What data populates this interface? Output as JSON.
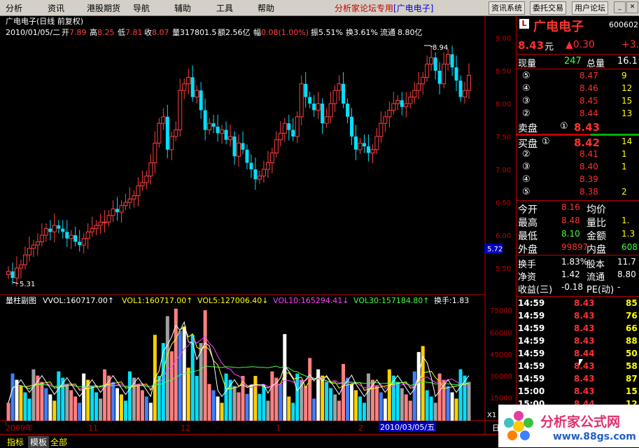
{
  "menu": {
    "items": [
      "分析",
      "资讯",
      "港股期货",
      "导航",
      "辅助",
      "工具",
      "帮助"
    ],
    "forum_label": "分析家论坛专用",
    "stock_bracket": "[广电电子]",
    "buttons": [
      "资讯系统",
      "委托交易",
      "用户论坛"
    ]
  },
  "chart_info": {
    "stock_name": "广电电子(日线 前复权)",
    "date": "2010/01/05/二",
    "open_label": "开",
    "open": "7.89",
    "high_label": "高",
    "high": "8.25",
    "low_label": "低",
    "low": "7.81",
    "close_label": "收",
    "close": "8.07",
    "volume_label": "量",
    "volume": "317801.5",
    "amount_label": "额",
    "amount": "2.56亿",
    "change_label": "幅",
    "change": "0.08(1.00%)",
    "amplitude_label": "振",
    "amplitude": "5.51%",
    "turnover_label": "换",
    "turnover": "3.61%",
    "float_label": "流通",
    "float": "8.80亿"
  },
  "indicator_info": {
    "title": "量柱副图",
    "vvol": "VVOL:160717.00↑",
    "vol1": "VOL1:160717.00↑",
    "vol5": "VOL5:127006.40↓",
    "vol10": "VOL10:165294.41↓",
    "vol30": "VOL30:157184.80↑",
    "huanshou": "换手:1.83"
  },
  "chart_data": {
    "type": "candlestick",
    "y_axis_main": [
      "9.00",
      "8.50",
      "8.00",
      "7.50",
      "7.00",
      "6.50",
      "6.00",
      "5.50"
    ],
    "y_axis_volume": [
      "75000",
      "60000",
      "45000",
      "30000",
      "15000"
    ],
    "x_labels": [
      "2009年",
      "11",
      "12",
      "1",
      "2"
    ],
    "max_annotation": "8.94",
    "min_annotation": "5.31",
    "current_price_marker": "5.72",
    "cursor_date": "2010/03/05/五",
    "volume_scale_label": "X1"
  },
  "quote": {
    "name": "广电电子",
    "code": "600602",
    "price": "8.43",
    "price_unit": "元",
    "change": "▲0.30",
    "change_pct": "+3.",
    "now_vol_label": "现量",
    "now_vol": "247",
    "total_vol_label": "总量",
    "total_vol": "16.1",
    "asks": [
      {
        "n": "⑤",
        "price": "8.47",
        "vol": "9"
      },
      {
        "n": "④",
        "price": "8.46",
        "vol": "12"
      },
      {
        "n": "③",
        "price": "8.45",
        "vol": "15"
      },
      {
        "n": "②",
        "price": "8.44",
        "vol": "13"
      },
      {
        "n": "①",
        "price": "8.43",
        "vol": ""
      }
    ],
    "bids": [
      {
        "n": "①",
        "price": "8.42",
        "vol": "14"
      },
      {
        "n": "②",
        "price": "8.41",
        "vol": "1"
      },
      {
        "n": "③",
        "price": "8.40",
        "vol": "1"
      },
      {
        "n": "④",
        "price": "8.39",
        "vol": ""
      },
      {
        "n": "⑤",
        "price": "8.38",
        "vol": "2"
      }
    ],
    "sell_label": "卖盘",
    "buy_label": "买盘",
    "stats": [
      [
        "今开",
        "8.16",
        "均价",
        ""
      ],
      [
        "最高",
        "8.48",
        "量比",
        "1."
      ],
      [
        "最低",
        "8.10",
        "金额",
        "1.3"
      ],
      [
        "外盘",
        "99897",
        "内盘",
        "608"
      ]
    ],
    "stats2": [
      [
        "换手",
        "1.83%",
        "股本",
        "11.7"
      ],
      [
        "净资",
        "1.42",
        "流通",
        "8.80"
      ],
      [
        "收益(三)",
        "-0.18",
        "PE(动)",
        "-"
      ]
    ],
    "ticks": [
      [
        "14:59",
        "8.43",
        "85"
      ],
      [
        "14:59",
        "8.43",
        "76"
      ],
      [
        "14:59",
        "8.43",
        "66"
      ],
      [
        "14:59",
        "8.43",
        "88"
      ],
      [
        "14:59",
        "8.44",
        "50"
      ],
      [
        "14:59",
        "8.43",
        "58"
      ],
      [
        "14:59",
        "8.43",
        "87"
      ],
      [
        "15:00",
        "8.43",
        "15"
      ],
      [
        "15:00",
        "8.44",
        "12"
      ]
    ]
  },
  "bottom_tabs": [
    "指标",
    "模板",
    "全部"
  ],
  "weekday_label": "日",
  "watermark": {
    "title": "分析家公式网",
    "url": "www.88gs.com"
  }
}
